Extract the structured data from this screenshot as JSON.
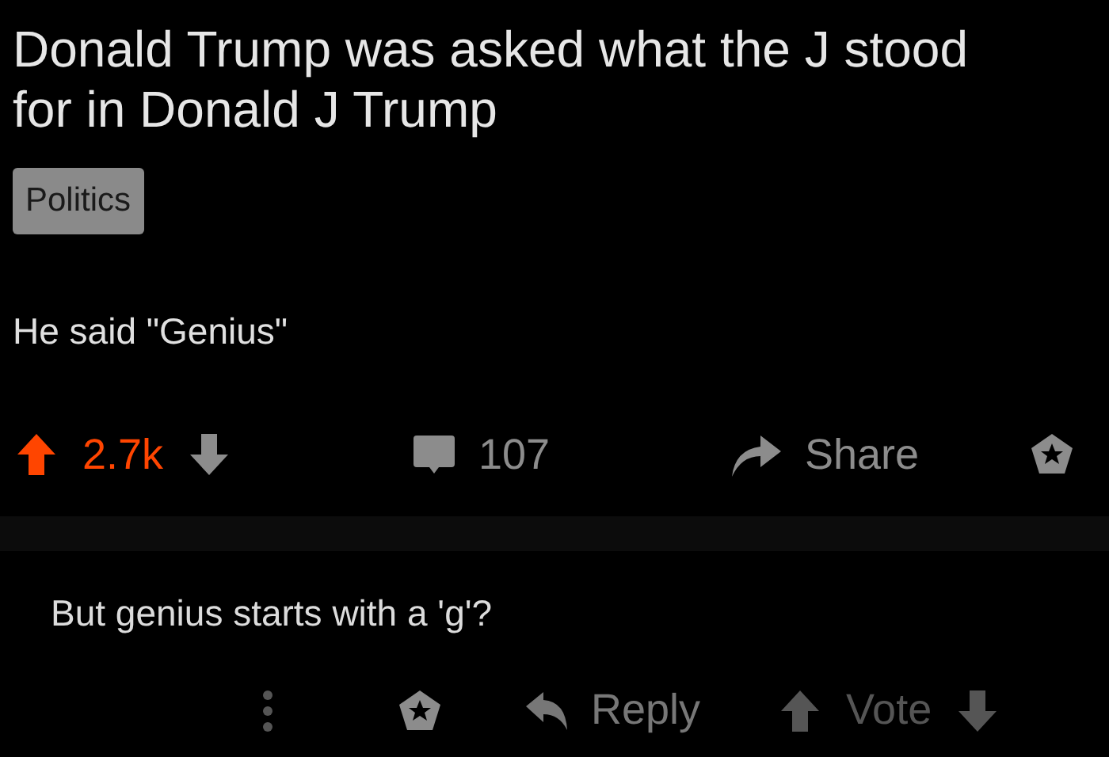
{
  "post": {
    "title": "Donald Trump was asked what the J stood for in Donald J Trump",
    "flair": "Politics",
    "body": "He said \"Genius\"",
    "upvoted": true,
    "score": "2.7k",
    "comments": "107",
    "share_label": "Share"
  },
  "comment": {
    "body": "But genius starts with a 'g'?",
    "reply_label": "Reply",
    "vote_label": "Vote"
  }
}
